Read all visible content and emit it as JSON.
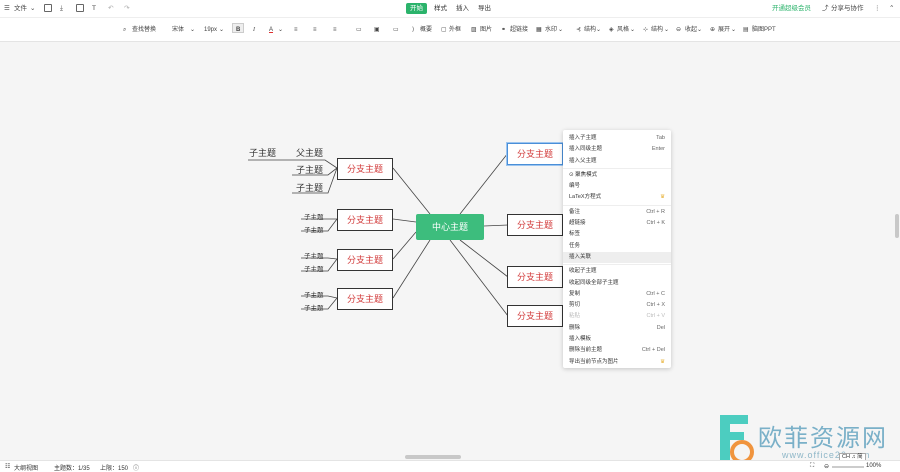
{
  "topbar": {
    "file_menu": "文件",
    "tabs": [
      "开始",
      "样式",
      "插入",
      "导出"
    ],
    "vip_link": "开通超级会员",
    "share_label": "分享与协作"
  },
  "toolbar": {
    "find_replace": "查找替换",
    "font_family": "宋体",
    "font_size": "19px",
    "bold": "B",
    "italic": "I",
    "font_color": "A",
    "summary": "概要",
    "outer_frame": "外框",
    "image": "图片",
    "hyperlink": "超链接",
    "watermark": "水印",
    "layout": "结构",
    "style": "风格",
    "structure": "结构",
    "collapse": "收起",
    "expand": "展开",
    "to_ppt": "脑图PPT"
  },
  "mindmap": {
    "center": "中心主题",
    "branches": [
      "分支主题",
      "分支主题",
      "分支主题",
      "分支主题",
      "分支主题",
      "分支主题",
      "分支主题",
      "分支主题"
    ],
    "parent_topic": "父主题",
    "subtopic": "子主题"
  },
  "context_menu": {
    "items": [
      {
        "label": "插入子主题",
        "shortcut": "Tab"
      },
      {
        "label": "插入同级主题",
        "shortcut": "Enter"
      },
      {
        "label": "插入父主题",
        "shortcut": ""
      },
      {
        "label": "聚焦模式",
        "shortcut": ""
      },
      {
        "label": "编号",
        "shortcut": ""
      },
      {
        "label": "LaTeX方程式",
        "shortcut": ""
      },
      {
        "label": "备注",
        "shortcut": "Ctrl + R"
      },
      {
        "label": "超链接",
        "shortcut": "Ctrl + K"
      },
      {
        "label": "标签",
        "shortcut": ""
      },
      {
        "label": "任务",
        "shortcut": ""
      },
      {
        "label": "插入关联",
        "shortcut": ""
      },
      {
        "label": "收起子主题",
        "shortcut": ""
      },
      {
        "label": "收起同级全部子主题",
        "shortcut": ""
      },
      {
        "label": "复制",
        "shortcut": "Ctrl + C"
      },
      {
        "label": "剪切",
        "shortcut": "Ctrl + X"
      },
      {
        "label": "粘贴",
        "shortcut": "Ctrl + V"
      },
      {
        "label": "删除",
        "shortcut": "Del"
      },
      {
        "label": "插入模板",
        "shortcut": ""
      },
      {
        "label": "删除当前主题",
        "shortcut": "Ctrl + Del"
      },
      {
        "label": "导出当前节点为图片",
        "shortcut": ""
      }
    ]
  },
  "statusbar": {
    "outline_view": "大纲视图",
    "topic_count": "主题数：1/35",
    "limit": "上限：150",
    "zoom": "100%",
    "ime": "CH ♫ 简"
  },
  "watermark": {
    "brand": "欧菲资源网",
    "url": "www.office26.com"
  },
  "colors": {
    "accent": "#2bb36b",
    "center_node": "#3dbd7d",
    "branch_text": "#d23a3a"
  }
}
